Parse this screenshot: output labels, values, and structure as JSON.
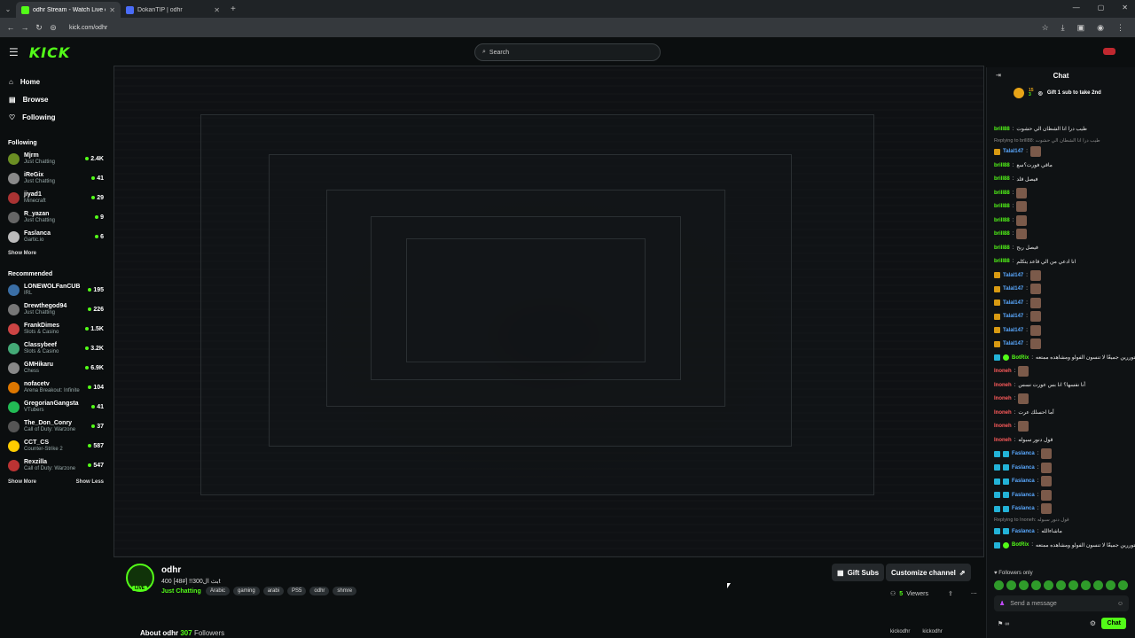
{
  "browser": {
    "tabs": [
      {
        "title": "odhr Stream - Watch Live on Ki",
        "active": true,
        "color": "#53fc18"
      },
      {
        "title": "DokanTIP | odhr",
        "active": false,
        "color": "#4a6cf7"
      }
    ],
    "url": "kick.com/odhr"
  },
  "nav": {
    "logo": "KICK",
    "search_placeholder": "Search"
  },
  "sidebar": {
    "main": [
      {
        "label": "Home",
        "icon": "home-icon"
      },
      {
        "label": "Browse",
        "icon": "browse-icon"
      },
      {
        "label": "Following",
        "icon": "heart-icon"
      }
    ],
    "following_header": "Following",
    "following": [
      {
        "name": "Mjrm",
        "category": "Just Chatting",
        "viewers": "2.4K"
      },
      {
        "name": "iReGix",
        "category": "Just Chatting",
        "viewers": "41"
      },
      {
        "name": "jiyad1",
        "category": "Minecraft",
        "viewers": "29"
      },
      {
        "name": "R_yazan",
        "category": "Just Chatting",
        "viewers": "9"
      },
      {
        "name": "Faslanca",
        "category": "Gartic.io",
        "viewers": "6"
      }
    ],
    "show_more": "Show More",
    "recommended_header": "Recommended",
    "recommended": [
      {
        "name": "LONEWOLFanCUB",
        "category": "IRL",
        "viewers": "195"
      },
      {
        "name": "Drewthegod94",
        "category": "Just Chatting",
        "viewers": "226"
      },
      {
        "name": "FrankDimes",
        "category": "Slots & Casino",
        "viewers": "1.5K"
      },
      {
        "name": "Classybeef",
        "category": "Slots & Casino",
        "viewers": "3.2K"
      },
      {
        "name": "GMHikaru",
        "category": "Chess",
        "viewers": "6.9K"
      },
      {
        "name": "nofacetv",
        "category": "Arena Breakout: Infinite",
        "viewers": "104"
      },
      {
        "name": "GregorianGangsta",
        "category": "VTubers",
        "viewers": "41"
      },
      {
        "name": "The_Don_Conry",
        "category": "Call of Duty: Warzone",
        "viewers": "37"
      },
      {
        "name": "CCT_CS",
        "category": "Counter-Strike 2",
        "viewers": "587"
      },
      {
        "name": "Rexzilla",
        "category": "Call of Duty: Warzone",
        "viewers": "547"
      }
    ],
    "show_more2": "Show More",
    "show_less": "Show Less"
  },
  "channel": {
    "name": "odhr",
    "title": "بث ال300!! [#48] 400t",
    "category": "Just Chatting",
    "tags": [
      "Arabic",
      "gaming",
      "arabi",
      "PS5",
      "odhr",
      "shmre"
    ],
    "live_label": "LIVE",
    "gift_subs": "Gift Subs",
    "customize": "Customize channel",
    "viewers_count": "5",
    "viewers_label": "Viewers",
    "about": "About odhr",
    "followers_count": "307",
    "followers_label": "Followers",
    "social1": "kickodhr",
    "social2": "kickodhr"
  },
  "chat": {
    "title": "Chat",
    "gift_count": "15",
    "gift_sub": "3",
    "gift_text": "Gift 1 sub to take 2nd",
    "messages": [
      {
        "user": "brill88",
        "text": "طيب درا انا الشطان الي حشوت",
        "type": "msg"
      },
      {
        "user": "",
        "text": "Replying to brill88: طيب درا انا الشطان الي حشوت",
        "type": "reply"
      },
      {
        "user": "Talal147",
        "text": "",
        "type": "emote",
        "badge": "yellow",
        "ucolor": "blue"
      },
      {
        "user": "brill88",
        "text": "ماقي فورت؟سع",
        "type": "msg"
      },
      {
        "user": "brill88",
        "text": "فيصل قلد",
        "type": "msg"
      },
      {
        "user": "brill88",
        "text": "",
        "type": "emote"
      },
      {
        "user": "brill88",
        "text": "",
        "type": "emote"
      },
      {
        "user": "brill88",
        "text": "",
        "type": "emote"
      },
      {
        "user": "brill88",
        "text": "",
        "type": "emote"
      },
      {
        "user": "brill88",
        "text": "فيصل ربح",
        "type": "msg"
      },
      {
        "user": "brill88",
        "text": "انا ادعي من الي قاعد يتكلم",
        "type": "msg"
      },
      {
        "user": "Talal147",
        "text": "",
        "type": "emote",
        "badge": "yellow",
        "ucolor": "blue"
      },
      {
        "user": "Talal147",
        "text": "",
        "type": "emote",
        "badge": "yellow",
        "ucolor": "blue"
      },
      {
        "user": "Talal147",
        "text": "",
        "type": "emote",
        "badge": "yellow",
        "ucolor": "blue"
      },
      {
        "user": "Talal147",
        "text": "",
        "type": "emote",
        "badge": "yellow",
        "ucolor": "blue"
      },
      {
        "user": "Talal147",
        "text": "",
        "type": "emote",
        "badge": "yellow",
        "ucolor": "blue"
      },
      {
        "user": "Talal147",
        "text": "",
        "type": "emote",
        "badge": "yellow",
        "ucolor": "blue"
      },
      {
        "user": "BotRix",
        "text": "متوررين جميعًا لا تنسون الفولو ومشاهده ممتعه ♥",
        "type": "msg",
        "badge": "green"
      },
      {
        "user": "Inoneh",
        "text": "",
        "type": "emote",
        "ucolor": "red"
      },
      {
        "user": "Inoneh",
        "text": "أنا نفسها؟ انا بس عورت نسس",
        "type": "msg",
        "ucolor": "red"
      },
      {
        "user": "Inoneh",
        "text": "",
        "type": "emote",
        "ucolor": "red"
      },
      {
        "user": "Inoneh",
        "text": "أما احسلك عرت",
        "type": "msg",
        "ucolor": "red"
      },
      {
        "user": "Inoneh",
        "text": "",
        "type": "emote",
        "ucolor": "red"
      },
      {
        "user": "Inoneh",
        "text": "قول دنور سبوله",
        "type": "msg",
        "ucolor": "red"
      },
      {
        "user": "Faslanca",
        "text": "",
        "type": "emote",
        "badge": "cyan",
        "ucolor": "blue"
      },
      {
        "user": "Faslanca",
        "text": "",
        "type": "emote",
        "badge": "cyan",
        "ucolor": "blue"
      },
      {
        "user": "Faslanca",
        "text": "",
        "type": "emote",
        "badge": "cyan",
        "ucolor": "blue"
      },
      {
        "user": "Faslanca",
        "text": "",
        "type": "emote",
        "badge": "cyan",
        "ucolor": "blue"
      },
      {
        "user": "Faslanca",
        "text": "",
        "type": "emote",
        "badge": "cyan",
        "ucolor": "blue"
      },
      {
        "user": "",
        "text": "Replying to Inoneh: قول دنور سبوله",
        "type": "reply"
      },
      {
        "user": "Faslanca",
        "text": "ماشاءالله",
        "type": "msg",
        "badge": "cyan",
        "ucolor": "blue"
      },
      {
        "user": "BotRix",
        "text": "متوررين جميعًا لا تنسون الفولو ومشاهده ممتعه ♥",
        "type": "msg",
        "badge": "green"
      }
    ],
    "followers_only": "Followers only",
    "send_placeholder": "Send a message",
    "chat_button": "Chat",
    "footer": "∞"
  },
  "colors": {
    "brand": "#53fc18",
    "bg": "#0b0e0f"
  }
}
